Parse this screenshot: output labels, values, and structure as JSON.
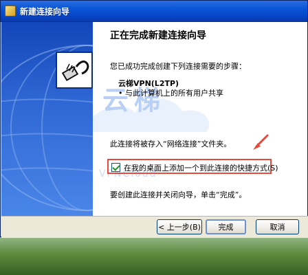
{
  "window": {
    "title": "新建连接向导"
  },
  "content": {
    "heading": "正在完成新建连接向导",
    "intro": "您已成功完成创建下列连接需要的步骤：",
    "connection_name": "云梯VPN(L2TP)",
    "bullet": "• 与此计算机上的所有用户共享",
    "folder_note": "此连接将被存入“网络连接”文件夹。",
    "checkbox_label": "在我的桌面上添加一个到此连接的快捷方式(S)",
    "finish_note": "要创建此连接并关闭向导，单击“完成”。"
  },
  "watermark": {
    "brand_cn": "云梯",
    "brand_en": "VPNCloud"
  },
  "buttons": {
    "back": "< 上一步(B)",
    "finish": "完成",
    "cancel": "取消"
  },
  "colors": {
    "titlebar": "#0b57d8",
    "highlight": "#e64a3e"
  },
  "icons": {
    "window_icon": "network-folder-icon",
    "wizard_icon": "network-cable-icon",
    "arrow_icon": "red-arrow-icon",
    "checkbox_state": "checked"
  }
}
